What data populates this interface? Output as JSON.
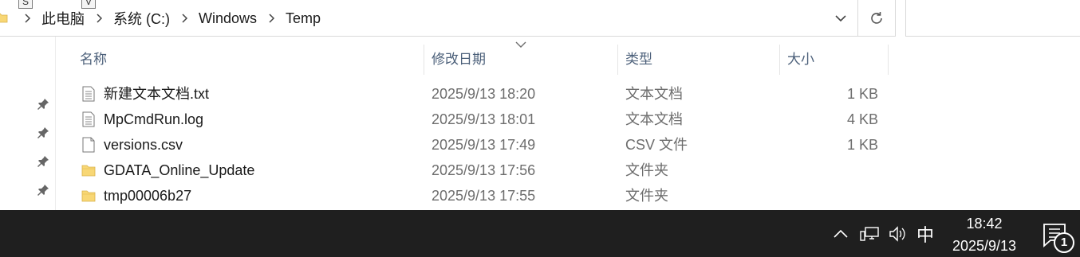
{
  "address_bar": {
    "breadcrumbs": [
      "此电脑",
      "系统 (C:)",
      "Windows",
      "Temp"
    ],
    "key_tips": [
      "S",
      "V"
    ]
  },
  "columns": [
    {
      "label": "名称"
    },
    {
      "label": "修改日期"
    },
    {
      "label": "类型"
    },
    {
      "label": "大小"
    }
  ],
  "files": [
    {
      "name": "新建文本文档.txt",
      "date": "2025/9/13 18:20",
      "type": "文本文档",
      "size": "1 KB",
      "icon": "text-file-icon"
    },
    {
      "name": "MpCmdRun.log",
      "date": "2025/9/13 18:01",
      "type": "文本文档",
      "size": "4 KB",
      "icon": "text-file-icon"
    },
    {
      "name": "versions.csv",
      "date": "2025/9/13 17:49",
      "type": "CSV 文件",
      "size": "1 KB",
      "icon": "blank-file-icon"
    },
    {
      "name": "GDATA_Online_Update",
      "date": "2025/9/13 17:56",
      "type": "文件夹",
      "size": "",
      "icon": "folder-icon"
    },
    {
      "name": "tmp00006b27",
      "date": "2025/9/13 17:55",
      "type": "文件夹",
      "size": "",
      "icon": "folder-icon"
    }
  ],
  "taskbar": {
    "ime": "中",
    "time": "18:42",
    "date": "2025/9/13",
    "notification_count": "1"
  },
  "colors": {
    "folder": "#f8d775",
    "taskbar_bg": "#1f1f1f",
    "header_text": "#4c607a"
  }
}
